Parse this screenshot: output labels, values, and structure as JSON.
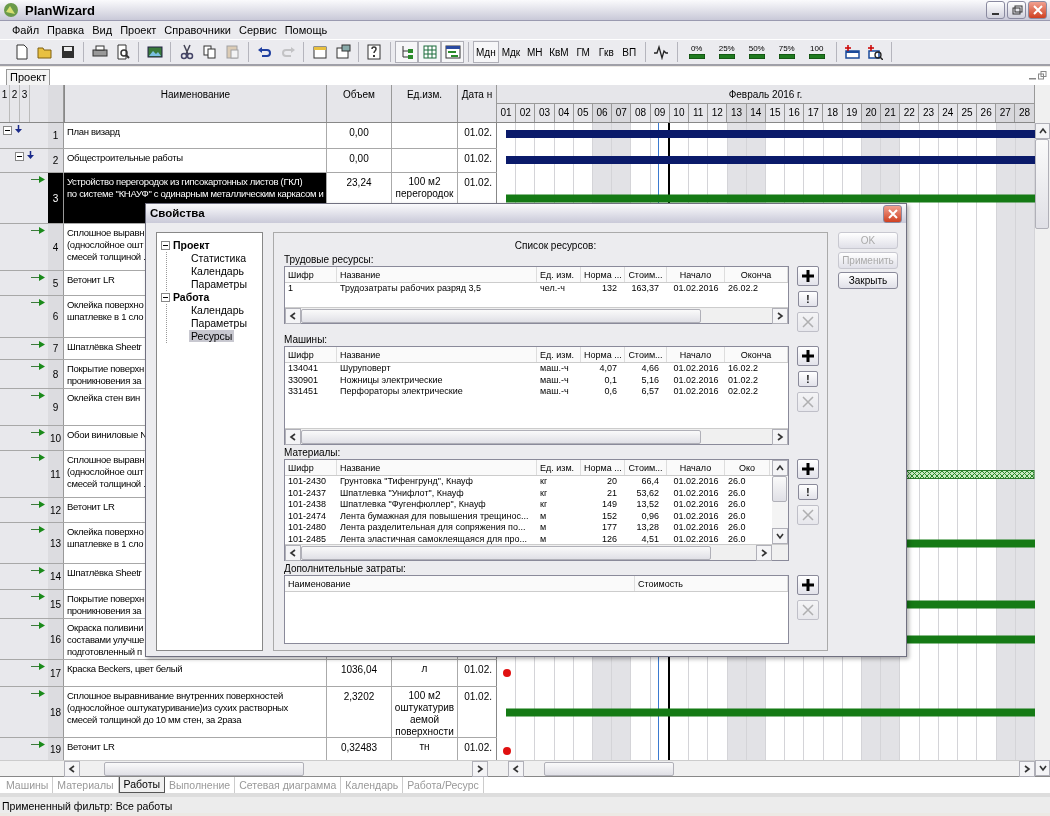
{
  "window": {
    "title": "PlanWizard"
  },
  "menu": [
    "Файл",
    "Правка",
    "Вид",
    "Проект",
    "Справочники",
    "Сервис",
    "Помощь"
  ],
  "toolbar": {
    "groups": [
      {
        "items": [
          {
            "kind": "icon",
            "disabled": false
          },
          {
            "kind": "icon",
            "disabled": false
          },
          {
            "kind": "icon",
            "disabled": false
          }
        ]
      },
      {
        "items": [
          {
            "kind": "icon",
            "disabled": false
          },
          {
            "kind": "icon",
            "disabled": false
          }
        ]
      },
      {
        "items": [
          {
            "kind": "icon",
            "disabled": false
          }
        ]
      },
      {
        "items": [
          {
            "kind": "icon",
            "disabled": false
          },
          {
            "kind": "icon",
            "disabled": false
          },
          {
            "kind": "icon",
            "disabled": true
          }
        ]
      },
      {
        "items": [
          {
            "kind": "icon",
            "disabled": false
          },
          {
            "kind": "icon",
            "disabled": true
          }
        ]
      },
      {
        "items": [
          {
            "kind": "icon",
            "disabled": false
          },
          {
            "kind": "icon",
            "disabled": false
          }
        ]
      },
      {
        "items": [
          {
            "kind": "icon",
            "disabled": false
          }
        ]
      },
      {
        "items": [
          {
            "kind": "icon",
            "pressed": true
          },
          {
            "kind": "icon",
            "pressed": true
          },
          {
            "kind": "icon",
            "pressed": true
          }
        ]
      },
      {
        "items": [
          {
            "kind": "text",
            "label": "Мдн",
            "pressed": true
          },
          {
            "kind": "text",
            "label": "Мдк",
            "pressed": false
          },
          {
            "kind": "text",
            "label": "МН",
            "pressed": false
          },
          {
            "kind": "text",
            "label": "КвМ",
            "pressed": false
          },
          {
            "kind": "text",
            "label": "ГМ",
            "pressed": false
          },
          {
            "kind": "text",
            "label": "Гкв",
            "pressed": false
          },
          {
            "kind": "text",
            "label": "ВП",
            "pressed": false
          }
        ]
      },
      {
        "items": [
          {
            "kind": "icon",
            "disabled": false
          }
        ]
      },
      {
        "items": [
          {
            "kind": "progress",
            "label": "0%"
          },
          {
            "kind": "progress",
            "label": "25%"
          },
          {
            "kind": "progress",
            "label": "50%"
          },
          {
            "kind": "progress",
            "label": "75%"
          },
          {
            "kind": "progress",
            "label": "100"
          }
        ]
      },
      {
        "items": [
          {
            "kind": "icon",
            "disabled": false
          },
          {
            "kind": "icon",
            "disabled": false
          }
        ]
      }
    ]
  },
  "document_tabs": [
    {
      "label": "Проект",
      "selected": true
    }
  ],
  "table": {
    "levels": [
      "1",
      "2",
      "3"
    ],
    "columns": [
      "Наименование",
      "Объем",
      "Ед.изм.",
      "Дата н"
    ],
    "timeline": {
      "month": "Февраль 2016 г.",
      "days": [
        {
          "label": "01",
          "weekend": false
        },
        {
          "label": "02",
          "weekend": false
        },
        {
          "label": "03",
          "weekend": false
        },
        {
          "label": "04",
          "weekend": false
        },
        {
          "label": "05",
          "weekend": false
        },
        {
          "label": "06",
          "weekend": true
        },
        {
          "label": "07",
          "weekend": true
        },
        {
          "label": "08",
          "weekend": false
        },
        {
          "label": "09",
          "weekend": false
        },
        {
          "label": "10",
          "weekend": false
        },
        {
          "label": "11",
          "weekend": false
        },
        {
          "label": "12",
          "weekend": false
        },
        {
          "label": "13",
          "weekend": true
        },
        {
          "label": "14",
          "weekend": true
        },
        {
          "label": "15",
          "weekend": false
        },
        {
          "label": "16",
          "weekend": false
        },
        {
          "label": "17",
          "weekend": false
        },
        {
          "label": "18",
          "weekend": false
        },
        {
          "label": "19",
          "weekend": false
        },
        {
          "label": "20",
          "weekend": true
        },
        {
          "label": "21",
          "weekend": true
        },
        {
          "label": "22",
          "weekend": false
        },
        {
          "label": "23",
          "weekend": false
        },
        {
          "label": "24",
          "weekend": false
        },
        {
          "label": "25",
          "weekend": false
        },
        {
          "label": "26",
          "weekend": false
        },
        {
          "label": "27",
          "weekend": true
        },
        {
          "label": "28",
          "weekend": true
        }
      ]
    },
    "rows": [
      {
        "number": "1",
        "name": "План визард",
        "volume": "0,00",
        "date": "01.02.",
        "kind": "summary",
        "selected": false,
        "expanded": true,
        "children": [
          {
            "number": "2",
            "name": "Общестроительные работы",
            "volume": "0,00",
            "date": "01.02.",
            "kind": "summary",
            "selected": false,
            "expanded": true,
            "children": [
              {
                "number": "3",
                "name": "Устройство перегородок из гипсокартонных листов (ГКЛ)\nпо системе \"КНАУФ\" с одинарным металлическим каркасом и",
                "volume": "23,24",
                "unit": "100 м2\nперегородок",
                "date": "01.02.",
                "kind": "task",
                "selected": true
              },
              {
                "number": "4",
                "name": "Сплошное выравн\n(однослойное ошт\nсмесей толщиной .",
                "kind": "plain",
                "selected": false
              },
              {
                "number": "5",
                "name": "Ветонит LR",
                "kind": "plain",
                "selected": false
              },
              {
                "number": "6",
                "name": "Оклейка поверхно\nшпатлевке в 1 сло",
                "kind": "plain",
                "selected": false
              },
              {
                "number": "7",
                "name": "Шпатлёвка Sheetr",
                "kind": "plain",
                "selected": false
              },
              {
                "number": "8",
                "name": "Покрытие поверхн\nпроникновения за",
                "kind": "plain",
                "selected": false
              },
              {
                "number": "9",
                "name": "Оклейка стен вин",
                "kind": "plain",
                "selected": false
              },
              {
                "number": "10",
                "name": "Обои виниловые N",
                "kind": "plain",
                "selected": false
              },
              {
                "number": "11",
                "name": "Сплошное выравн\n(однослойное ошт\nсмесей толщиной .",
                "kind": "hatched",
                "selected": false
              },
              {
                "number": "12",
                "name": "Ветонит LR",
                "kind": "plain",
                "selected": false
              },
              {
                "number": "13",
                "name": "Оклейка поверхно\nшпатлевке в 1 сло",
                "kind": "task",
                "selected": false
              },
              {
                "number": "14",
                "name": "Шпатлёвка Sheetr",
                "kind": "plain",
                "selected": false
              },
              {
                "number": "15",
                "name": "Покрытие поверхн\nпроникновения за",
                "kind": "task",
                "selected": false
              },
              {
                "number": "16",
                "name": "Окраска поливини\nсоставами улучше\nподготовленный п",
                "kind": "task",
                "selected": false
              },
              {
                "number": "17",
                "name": "Краска Beckers, цвет белый",
                "volume": "1036,04",
                "unit": "л",
                "date": "01.02.",
                "kind": "milestone",
                "selected": false
              },
              {
                "number": "18",
                "name": "Сплошное выравнивание внутренних поверхностей\n(однослойное оштукатуривание)из сухих растворных\nсмесей толщиной до 10 мм стен, за 2раза",
                "volume": "2,3202",
                "unit": "100 м2\nоштукатурив\nаемой\nповерхности",
                "date": "01.02.",
                "kind": "task",
                "selected": false
              },
              {
                "number": "19",
                "name": "Ветонит LR",
                "volume": "0,32483",
                "unit": "тн",
                "date": "01.02.",
                "kind": "milestone",
                "selected": false
              }
            ]
          }
        ]
      }
    ]
  },
  "bottom_tabs": [
    {
      "label": "Машины",
      "selected": false
    },
    {
      "label": "Материалы",
      "selected": false
    },
    {
      "label": "Работы",
      "selected": true
    },
    {
      "label": "Выполнение",
      "selected": false
    },
    {
      "label": "Сетевая диаграмма",
      "selected": false
    },
    {
      "label": "Календарь",
      "selected": false
    },
    {
      "label": "Работа/Ресурс",
      "selected": false
    }
  ],
  "status_bar": "Примененный фильтр: Все работы",
  "dialog": {
    "title": "Свойства",
    "tree": [
      {
        "label": "Проект",
        "expanded": true,
        "children": [
          {
            "label": "Статистика",
            "selected": false
          },
          {
            "label": "Календарь",
            "selected": false
          },
          {
            "label": "Параметры",
            "selected": false
          }
        ]
      },
      {
        "label": "Работа",
        "expanded": true,
        "children": [
          {
            "label": "Календарь",
            "selected": false
          },
          {
            "label": "Параметры",
            "selected": false
          },
          {
            "label": "Ресурсы",
            "selected": true
          }
        ]
      }
    ],
    "heading": "Список ресурсов:",
    "sections": [
      {
        "label": "Трудовые ресурсы:",
        "columns": [
          "Шифр",
          "Название",
          "Ед. изм.",
          "Норма ...",
          "Стоим...",
          "Начало",
          "Оконча"
        ],
        "rows": [
          [
            "1",
            "Трудозатраты рабочих разряд 3,5",
            "чел.-ч",
            "132",
            "163,37",
            "01.02.2016",
            "26.02.2"
          ]
        ],
        "buttons": [
          {
            "kind": "add",
            "disabled": false
          },
          {
            "kind": "edit",
            "label": "!",
            "disabled": false
          },
          {
            "kind": "delete",
            "disabled": true
          }
        ]
      },
      {
        "label": "Машины:",
        "columns": [
          "Шифр",
          "Название",
          "Ед. изм.",
          "Норма ...",
          "Стоим...",
          "Начало",
          "Оконча"
        ],
        "rows": [
          [
            "134041",
            "Шуруповерт",
            "маш.-ч",
            "4,07",
            "4,66",
            "01.02.2016",
            "16.02.2"
          ],
          [
            "330901",
            "Ножницы электрические",
            "маш.-ч",
            "0,1",
            "5,16",
            "01.02.2016",
            "01.02.2"
          ],
          [
            "331451",
            "Перфораторы электрические",
            "маш.-ч",
            "0,6",
            "6,57",
            "01.02.2016",
            "02.02.2"
          ]
        ],
        "buttons": [
          {
            "kind": "add",
            "disabled": false
          },
          {
            "kind": "edit",
            "label": "!",
            "disabled": false
          },
          {
            "kind": "delete",
            "disabled": true
          }
        ]
      },
      {
        "label": "Материалы:",
        "vertical_scroll": true,
        "columns": [
          "Шифр",
          "Название",
          "Ед. изм.",
          "Норма ...",
          "Стоим...",
          "Начало",
          "Око"
        ],
        "rows": [
          [
            "101-2430",
            "Грунтовка \"Тифенгрунд\", Кнауф",
            "кг",
            "20",
            "66,4",
            "01.02.2016",
            "26.0"
          ],
          [
            "101-2437",
            "Шпатлевка \"Унифлот\", Кнауф",
            "кг",
            "21",
            "53,62",
            "01.02.2016",
            "26.0"
          ],
          [
            "101-2438",
            "Шпатлевка \"Фугенфюллер\", Кнауф",
            "кг",
            "149",
            "13,52",
            "01.02.2016",
            "26.0"
          ],
          [
            "101-2474",
            "Лента бумажная для повышения трещинос...",
            "м",
            "152",
            "0,96",
            "01.02.2016",
            "26.0"
          ],
          [
            "101-2480",
            "Лента разделительная для сопряжения по...",
            "м",
            "177",
            "13,28",
            "01.02.2016",
            "26.0"
          ],
          [
            "101-2485",
            "Лента эластичная самоклеящаяся для про...",
            "м",
            "126",
            "4,51",
            "01.02.2016",
            "26.0"
          ]
        ],
        "buttons": [
          {
            "kind": "add",
            "disabled": false
          },
          {
            "kind": "edit",
            "label": "!",
            "disabled": false
          },
          {
            "kind": "delete",
            "disabled": true
          }
        ]
      },
      {
        "label": "Дополнительные затраты:",
        "columns": [
          "Наименование",
          "Стоимость"
        ],
        "buttons": [
          {
            "kind": "add",
            "disabled": false
          },
          {
            "kind": "delete",
            "disabled": true
          }
        ]
      }
    ],
    "buttons": [
      {
        "label": "OK",
        "disabled": true
      },
      {
        "label": "Применить",
        "disabled": true
      },
      {
        "label": "Закрыть",
        "disabled": false
      }
    ]
  }
}
